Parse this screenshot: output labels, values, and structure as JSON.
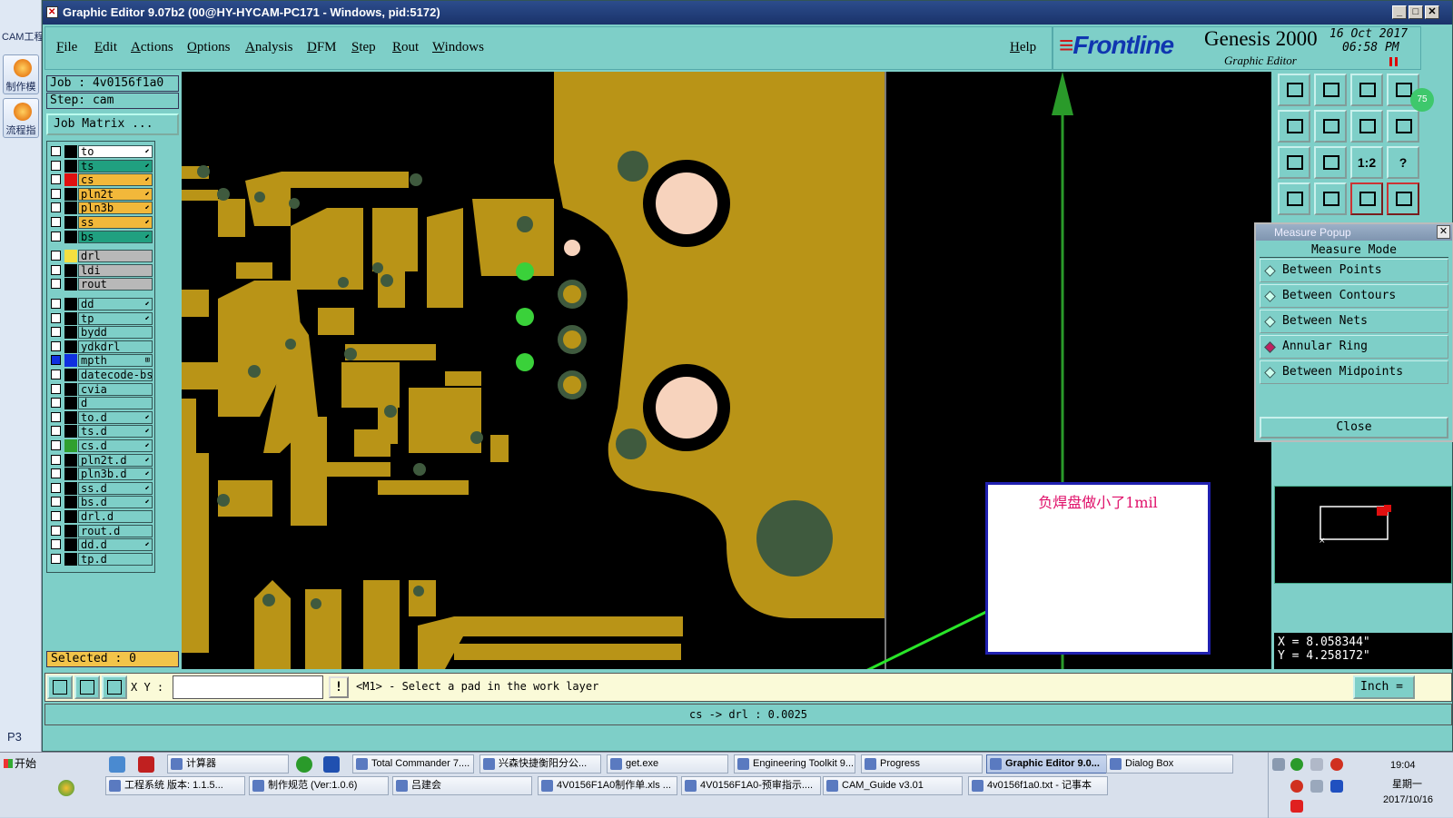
{
  "left_strip": {
    "label": "CAM工程",
    "btn1": "制作模",
    "btn2": "流程指",
    "footer": "P3"
  },
  "window": {
    "title": "Graphic Editor 9.07b2 (00@HY-HYCAM-PC171 - Windows, pid:5172)",
    "controls": [
      "_",
      "□",
      "✕"
    ]
  },
  "menu": {
    "items": [
      "File",
      "Edit",
      "Actions",
      "Options",
      "Analysis",
      "DFM",
      "Step",
      "Rout",
      "Windows"
    ],
    "help": "Help"
  },
  "brand": {
    "logo_mark": "≡",
    "logo": "Frontline",
    "product": "Genesis 2000",
    "subtitle": "Graphic Editor",
    "date": "16 Oct 2017",
    "time": "06:58 PM"
  },
  "left_panel": {
    "job": "Job : 4v0156f1a0",
    "step": "Step: cam",
    "job_matrix": "Job Matrix ...",
    "selected": "Selected : 0",
    "layers": [
      {
        "name": "to",
        "swatch": "#000000",
        "bg": "#ffffff",
        "arrow": "⬋"
      },
      {
        "name": "ts",
        "swatch": "#000000",
        "bg": "#20a080",
        "arrow": "⬋"
      },
      {
        "name": "cs",
        "swatch": "#e01010",
        "bg": "#f2b83a",
        "arrow": "⬋"
      },
      {
        "name": "pln2t",
        "swatch": "#000000",
        "bg": "#f2b83a",
        "arrow": "⬋"
      },
      {
        "name": "pln3b",
        "swatch": "#000000",
        "bg": "#f2b83a",
        "arrow": "⬋"
      },
      {
        "name": "ss",
        "swatch": "#000000",
        "bg": "#f2b83a",
        "arrow": "⬋"
      },
      {
        "name": "bs",
        "swatch": "#000000",
        "bg": "#20a080",
        "arrow": "⬋"
      },
      {
        "name": "drl",
        "swatch": "#f5e040",
        "bg": "#b8b8b8",
        "arrow": ""
      },
      {
        "name": "ldi",
        "swatch": "#000000",
        "bg": "#b8b8b8",
        "arrow": ""
      },
      {
        "name": "rout",
        "swatch": "#000000",
        "bg": "#b8b8b8",
        "arrow": ""
      },
      {
        "name": "dd",
        "swatch": "#000000",
        "bg": "#7ecfc8",
        "arrow": "⬋"
      },
      {
        "name": "tp",
        "swatch": "#000000",
        "bg": "#7ecfc8",
        "arrow": "⬋"
      },
      {
        "name": "bydd",
        "swatch": "#000000",
        "bg": "#7ecfc8",
        "arrow": ""
      },
      {
        "name": "ydkdrl",
        "swatch": "#000000",
        "bg": "#7ecfc8",
        "arrow": ""
      },
      {
        "name": "mpth",
        "swatch": "#1030e0",
        "bg": "#7ecfc8",
        "arrow": "⊞"
      },
      {
        "name": "datecode-bs",
        "swatch": "#000000",
        "bg": "#7ecfc8",
        "arrow": ""
      },
      {
        "name": "cvia",
        "swatch": "#000000",
        "bg": "#7ecfc8",
        "arrow": ""
      },
      {
        "name": "d",
        "swatch": "#000000",
        "bg": "#7ecfc8",
        "arrow": ""
      },
      {
        "name": "to.d",
        "swatch": "#000000",
        "bg": "#7ecfc8",
        "arrow": "⬋"
      },
      {
        "name": "ts.d",
        "swatch": "#000000",
        "bg": "#7ecfc8",
        "arrow": "⬋"
      },
      {
        "name": "cs.d",
        "swatch": "#30a030",
        "bg": "#7ecfc8",
        "arrow": "⬋"
      },
      {
        "name": "pln2t.d",
        "swatch": "#000000",
        "bg": "#7ecfc8",
        "arrow": "⬋"
      },
      {
        "name": "pln3b.d",
        "swatch": "#000000",
        "bg": "#7ecfc8",
        "arrow": "⬋"
      },
      {
        "name": "ss.d",
        "swatch": "#000000",
        "bg": "#7ecfc8",
        "arrow": "⬋"
      },
      {
        "name": "bs.d",
        "swatch": "#000000",
        "bg": "#7ecfc8",
        "arrow": "⬋"
      },
      {
        "name": "drl.d",
        "swatch": "#000000",
        "bg": "#7ecfc8",
        "arrow": ""
      },
      {
        "name": "rout.d",
        "swatch": "#000000",
        "bg": "#7ecfc8",
        "arrow": ""
      },
      {
        "name": "dd.d",
        "swatch": "#000000",
        "bg": "#7ecfc8",
        "arrow": "⬋"
      },
      {
        "name": "tp.d",
        "swatch": "#000000",
        "bg": "#7ecfc8",
        "arrow": ""
      }
    ]
  },
  "tools": {
    "labels": [
      "",
      "",
      "",
      "",
      "",
      "",
      "",
      "",
      "",
      "",
      "1:2",
      "?",
      "",
      "",
      "",
      ""
    ],
    "badge": "75"
  },
  "measure_popup": {
    "title": "Measure Popup",
    "mode_label": "Measure Mode",
    "options": [
      "Between Points",
      "Between Contours",
      "Between Nets",
      "Annular Ring",
      "Between Midpoints"
    ],
    "selected_index": 3,
    "close": "Close"
  },
  "coords": {
    "x": "X = 8.058344\"",
    "y": "Y = 4.258172\""
  },
  "callout": {
    "text": "负焊盘做小了1mil"
  },
  "command_bar": {
    "xy_label": "X Y :",
    "xy_value": "",
    "excl": "!",
    "prompt": "<M1> - Select a pad in the work layer",
    "units": "Inch ="
  },
  "status": {
    "text": "cs -> drl : 0.0025"
  },
  "taskbar": {
    "start": "开始",
    "row1": [
      "计算器",
      "Total Commander 7....",
      "兴森快捷衡阳分公...",
      "get.exe",
      "Engineering Toolkit 9....",
      "Progress",
      "Graphic Editor 9.0...",
      "Dialog Box"
    ],
    "row2": [
      "工程系统  版本: 1.1.5...",
      "制作规范 (Ver:1.0.6)",
      "吕建会",
      "4V0156F1A0制作单.xls ...",
      "4V0156F1A0-预审指示....",
      "CAM_Guide v3.01",
      "4v0156f1a0.txt - 记事本"
    ],
    "clock_time": "19:04",
    "clock_day": "星期一",
    "clock_date": "2017/10/16"
  },
  "colors": {
    "panel_teal": "#7ecfc8",
    "copper": "#b99417",
    "plane_dot": "#3f5a3e",
    "drill_fill": "#f7d3bd",
    "green_pad": "#3ad13a",
    "arrow_green": "#29e629"
  }
}
